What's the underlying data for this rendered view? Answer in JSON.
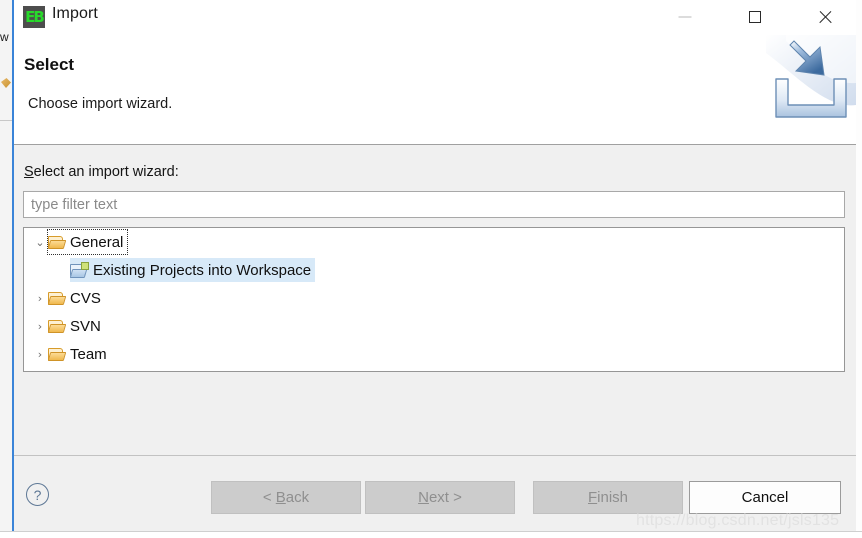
{
  "window": {
    "title": "Import",
    "app_icon": "eclipse-eb-icon",
    "icon_text": "EB",
    "controls": {
      "minimize_label": "–",
      "maximize_label": "□",
      "close_label": "✕"
    }
  },
  "header": {
    "title": "Select",
    "subtitle": "Choose import wizard.",
    "banner_icon": "import-banner-icon"
  },
  "content": {
    "tree_label_mnemonic": "S",
    "tree_label_rest": "elect an import wizard:",
    "filter": {
      "value": "",
      "placeholder": "type filter text"
    },
    "tree": [
      {
        "label": "General",
        "level": 1,
        "expanded": true,
        "twisty": "⌄",
        "icon": "folder-open-icon",
        "selected": false,
        "focused": true
      },
      {
        "label": "Existing Projects into Workspace",
        "level": 2,
        "expanded": null,
        "twisty": "",
        "icon": "folder-import-icon",
        "selected": true,
        "focused": false
      },
      {
        "label": "CVS",
        "level": 1,
        "expanded": false,
        "twisty": "›",
        "icon": "folder-open-icon",
        "selected": false,
        "focused": false
      },
      {
        "label": "SVN",
        "level": 1,
        "expanded": false,
        "twisty": "›",
        "icon": "folder-open-icon",
        "selected": false,
        "focused": false
      },
      {
        "label": "Team",
        "level": 1,
        "expanded": false,
        "twisty": "›",
        "icon": "folder-open-icon",
        "selected": false,
        "focused": false
      }
    ]
  },
  "buttons": {
    "help": {
      "label": "?",
      "icon": "help-question-icon",
      "enabled": true
    },
    "back": {
      "prefix": "< ",
      "mnemonic": "B",
      "rest": "ack",
      "suffix": "",
      "enabled": false
    },
    "next": {
      "prefix": "",
      "mnemonic": "N",
      "rest": "ext",
      "suffix": " >",
      "enabled": false
    },
    "finish": {
      "prefix": "",
      "mnemonic": "F",
      "rest": "inish",
      "suffix": "",
      "enabled": false
    },
    "cancel": {
      "prefix": "",
      "mnemonic": "",
      "rest": "Cancel",
      "suffix": "",
      "enabled": true
    }
  },
  "watermark": "https://blog.csdn.net/jsls135",
  "colors": {
    "dialog_bg": "#f0f0f0",
    "header_bg": "#ffffff",
    "selection": "#d7e9f8",
    "accent_blue": "#3a84d8",
    "icon_green": "#28d92b",
    "disabled_text": "#8f8f8f"
  }
}
